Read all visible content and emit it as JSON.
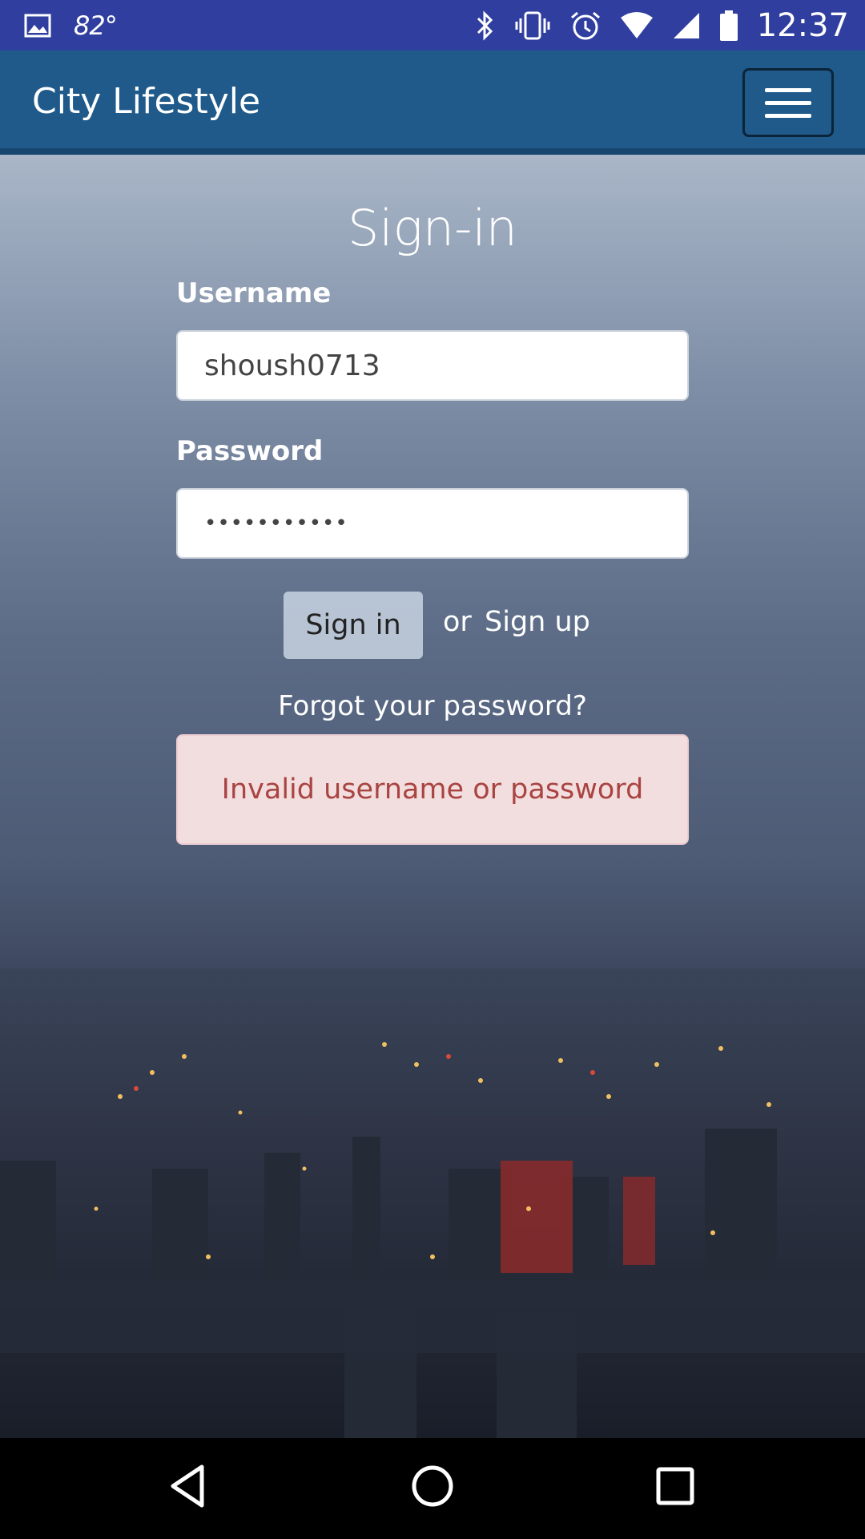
{
  "status_bar": {
    "temperature": "82°",
    "time": "12:37",
    "icons": [
      "image-icon",
      "bluetooth-icon",
      "vibrate-icon",
      "alarm-icon",
      "wifi-icon",
      "signal-icon",
      "battery-icon"
    ]
  },
  "navbar": {
    "brand": "City Lifestyle",
    "menu_icon": "hamburger-menu-icon"
  },
  "form": {
    "title": "Sign-in",
    "username_label": "Username",
    "username_value": "shoush0713",
    "password_label": "Password",
    "password_value": "•••••••••••",
    "signin_button": "Sign in",
    "or_text": "or",
    "signup_link": "Sign up",
    "forgot_link": "Forgot your password?",
    "error_message": "Invalid username or password"
  },
  "system_nav": {
    "back": "back-icon",
    "home": "home-icon",
    "recents": "recents-icon"
  },
  "colors": {
    "status_bar": "#303f9f",
    "navbar": "#1f5a8a",
    "alert_bg": "#f2dede",
    "alert_text": "#a94442"
  }
}
